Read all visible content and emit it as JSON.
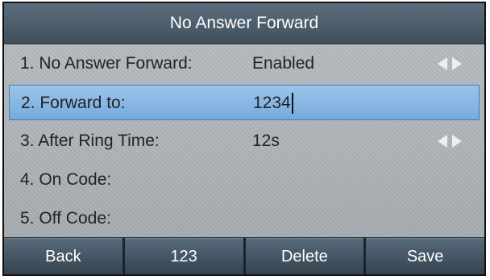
{
  "title": "No Answer Forward",
  "rows": [
    {
      "label": "1. No Answer Forward:",
      "value": "Enabled"
    },
    {
      "label": "2. Forward to:",
      "value": "1234"
    },
    {
      "label": "3. After Ring Time:",
      "value": "12s"
    },
    {
      "label": "4. On Code:",
      "value": ""
    },
    {
      "label": "5. Off Code:",
      "value": ""
    }
  ],
  "softkeys": {
    "back": "Back",
    "input_mode": "123",
    "delete": "Delete",
    "save": "Save"
  },
  "icons": {
    "left_arrow": "arrow-left-icon",
    "right_arrow": "arrow-right-icon"
  },
  "colors": {
    "title_bar": "#3f4f5c",
    "selection": "#77aadd",
    "screen_bg": "#aeb3b8",
    "text": "#1e2328"
  }
}
